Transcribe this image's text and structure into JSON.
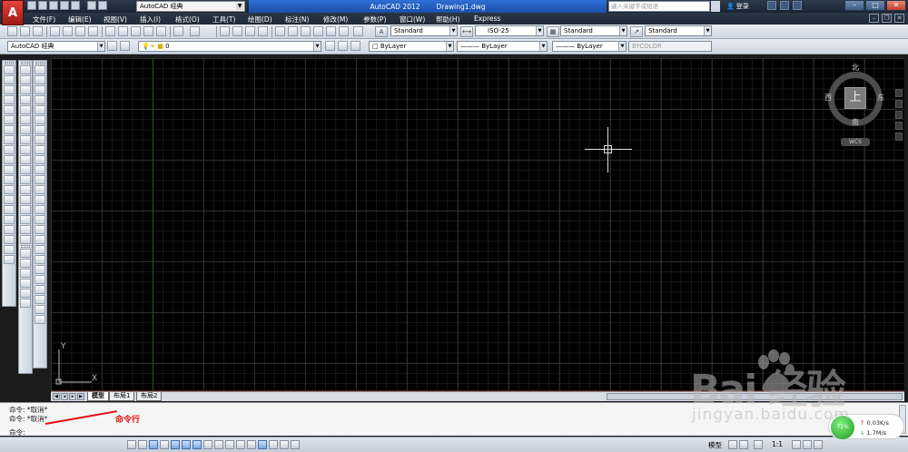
{
  "window": {
    "app_title": "AutoCAD 2012",
    "document_title": "Drawing1.dwg",
    "workspace": "AutoCAD 经典",
    "search_placeholder": "键入关键字或短语",
    "login": "登录",
    "logo_letter": "A"
  },
  "menu": [
    "文件(F)",
    "编辑(E)",
    "视图(V)",
    "插入(I)",
    "格式(O)",
    "工具(T)",
    "绘图(D)",
    "标注(N)",
    "修改(M)",
    "参数(P)",
    "窗口(W)",
    "帮助(H)",
    "Express"
  ],
  "toolbar1": {
    "text_style": "Standard",
    "dim_style": "ISO-25",
    "table_style": "Standard",
    "multileader_style": "Standard"
  },
  "toolbar2": {
    "workspace": "AutoCAD 经典",
    "layer": "0",
    "color": "ByLayer",
    "linetype": "ByLayer",
    "lineweight": "ByLayer",
    "plotstyle": "BYCOLOR"
  },
  "viewcube": {
    "top": "上",
    "north": "北",
    "south": "南",
    "east": "东",
    "west": "西",
    "wcs": "WCS"
  },
  "ucs": {
    "x": "X",
    "y": "Y"
  },
  "tabs": [
    "模型",
    "布局1",
    "布局2"
  ],
  "command": {
    "history": [
      "命令: *取消*",
      "命令: *取消*"
    ],
    "prompt": "命令:",
    "annotation": "命令行"
  },
  "status": {
    "model": "模型",
    "scale": "1:1"
  },
  "netmeter": {
    "percent": "71%",
    "up": "0.03K/s",
    "down": "1.7M/s"
  },
  "watermark": {
    "brand": "Bai  经验",
    "url": "jingyan.baidu.com"
  },
  "colors": {
    "canvas_bg": "#000000",
    "title_active": "#2e6fd6",
    "annotation": "#e01010"
  }
}
